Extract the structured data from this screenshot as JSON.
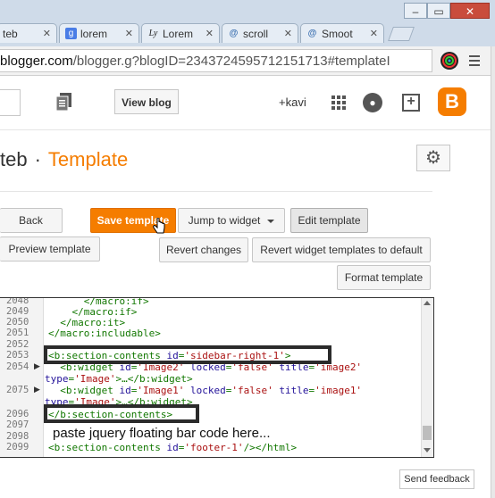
{
  "browser": {
    "tabs": [
      {
        "label": "teb",
        "favicon": "blogger-icon"
      },
      {
        "label": "lorem",
        "favicon": "google-icon"
      },
      {
        "label": "Lorem",
        "favicon": "lorem-ipsum-icon"
      },
      {
        "label": "scroll",
        "favicon": "stack-icon"
      },
      {
        "label": "Smoot",
        "favicon": "stack-icon"
      }
    ],
    "window_buttons": {
      "minimize": "–",
      "maximize": "▭",
      "close": "✕"
    },
    "url": {
      "host": "blogger.com",
      "path": "/blogger.g?blogID=2343724595712151713#templateI"
    }
  },
  "blogger_header": {
    "view_blog_label": "View blog",
    "user": "+kavi"
  },
  "page": {
    "blog_name": "teb",
    "separator": "·",
    "section": "Template"
  },
  "toolbar": {
    "back": "Back",
    "save": "Save template",
    "jump": "Jump to widget",
    "edit": "Edit template",
    "preview": "Preview template",
    "revert": "Revert changes",
    "revert_widgets": "Revert widget templates to default",
    "format": "Format template"
  },
  "editor": {
    "line_numbers": [
      "2048",
      "2049",
      "2050",
      "2051",
      "2052",
      "2053",
      "2054",
      "",
      "2075",
      "",
      "2096",
      "2097",
      "2098",
      "2099"
    ],
    "lines": [
      "      </macro:if>",
      "    </macro:if>",
      "  </macro:it>",
      "</macro:includable>",
      "",
      "<b:section-contents id='sidebar-right-1'>",
      "  <b:widget id='Image2' locked='false' title='image2'",
      "type='Image'>…</b:widget>",
      "  <b:widget id='Image1' locked='false' title='image1'",
      "type='Image'>…</b:widget>",
      "</b:section-contents>",
      "",
      "",
      "<b:section-contents id='footer-1'/></html>"
    ],
    "annotation": "paste jquery floating bar code here..."
  },
  "feedback_label": "Send feedback",
  "colors": {
    "accent": "#f57d00",
    "tag": "#117700",
    "string": "#aa1111"
  }
}
